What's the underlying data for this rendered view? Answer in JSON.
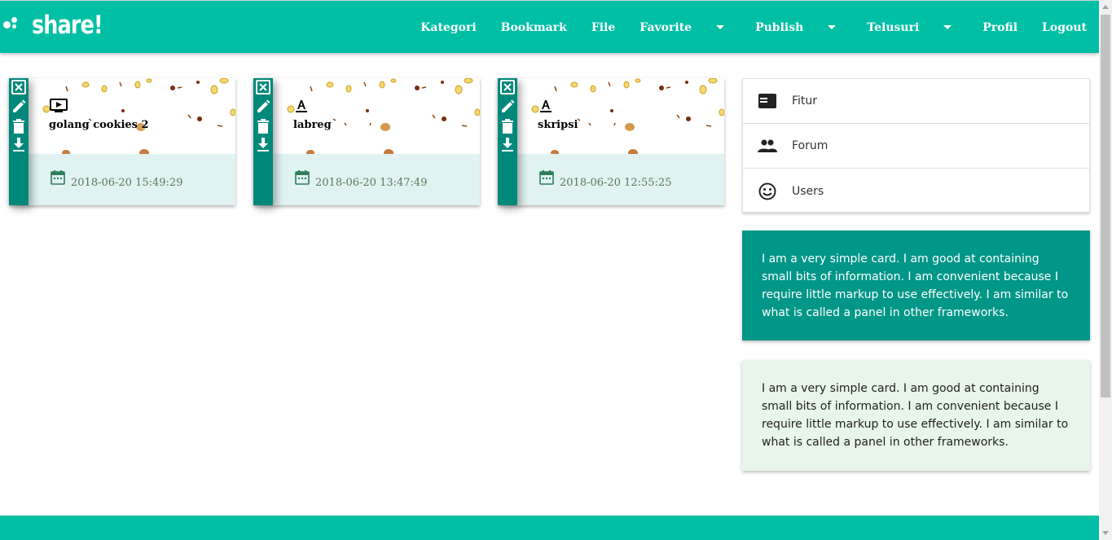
{
  "brand": {
    "name": "share!"
  },
  "nav": {
    "items": [
      {
        "label": "Kategori",
        "dropdown": false
      },
      {
        "label": "Bookmark",
        "dropdown": false
      },
      {
        "label": "File",
        "dropdown": false
      },
      {
        "label": "Favorite",
        "dropdown": true
      },
      {
        "label": "Publish",
        "dropdown": true
      },
      {
        "label": "Telusuri",
        "dropdown": true
      },
      {
        "label": "Profil",
        "dropdown": false
      },
      {
        "label": "Logout",
        "dropdown": false
      }
    ]
  },
  "files": [
    {
      "title": "golang cookies 2",
      "type_icon": "video-icon",
      "date": "2018-06-20 15:49:29"
    },
    {
      "title": "labreg",
      "type_icon": "text-format-icon",
      "date": "2018-06-20 13:47:49"
    },
    {
      "title": "skripsi",
      "type_icon": "text-format-icon",
      "date": "2018-06-20 12:55:25"
    }
  ],
  "card_actions": [
    "close-box-icon",
    "pencil-icon",
    "trash-icon",
    "download-icon"
  ],
  "sidebar": {
    "items": [
      {
        "label": "Fitur",
        "icon": "web-icon"
      },
      {
        "label": "Forum",
        "icon": "people-icon"
      },
      {
        "label": "Users",
        "icon": "smiley-icon"
      }
    ]
  },
  "info_cards": [
    {
      "text": "I am a very simple card. I am good at containing small bits of information. I am convenient because I require little markup to use effectively. I am similar to what is called a panel in other frameworks.",
      "color": "#009688"
    },
    {
      "text": "I am a very simple card. I am good at containing small bits of information. I am convenient because I require little markup to use effectively. I am similar to what is called a panel in other frameworks.",
      "color": "#e8f5e9"
    }
  ],
  "colors": {
    "primary": "#00bfa5",
    "sidebar_strip": "#00897b",
    "card_footer": "#e0f2f1"
  }
}
